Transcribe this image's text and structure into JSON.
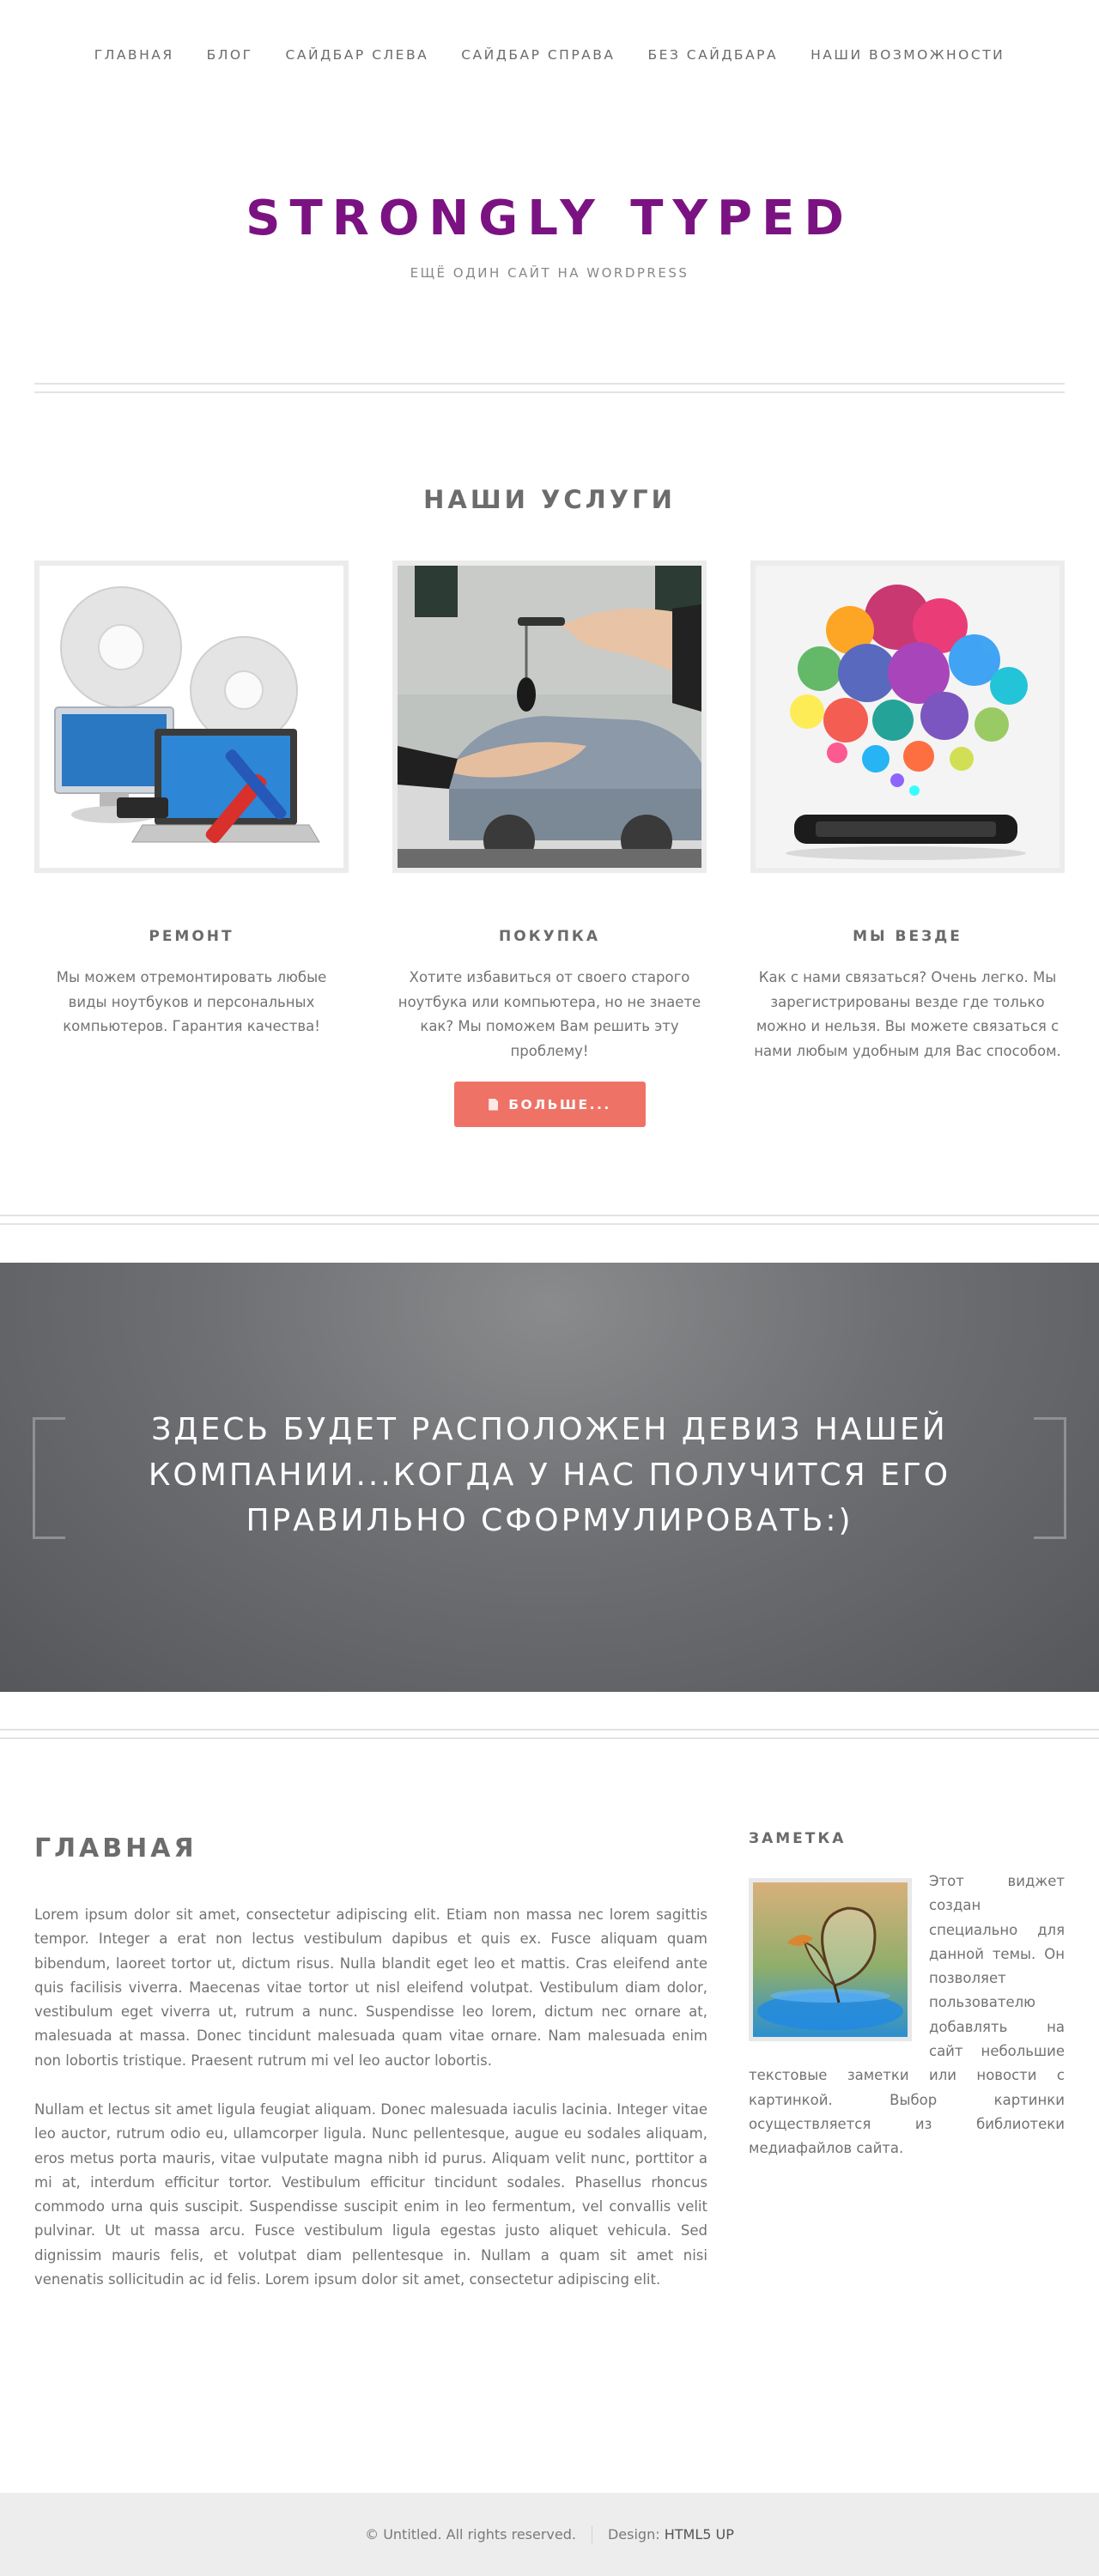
{
  "nav": {
    "items": [
      {
        "label": "ГЛАВНАЯ"
      },
      {
        "label": "БЛОГ"
      },
      {
        "label": "САЙДБАР СЛЕВА"
      },
      {
        "label": "САЙДБАР СПРАВА"
      },
      {
        "label": "БЕЗ САЙДБАРА"
      },
      {
        "label": "НАШИ ВОЗМОЖНОСТИ"
      }
    ]
  },
  "header": {
    "title": "STRONGLY TYPED",
    "tagline": "ЕЩЁ ОДИН САЙТ НА WORDPRESS"
  },
  "services": {
    "heading": "НАШИ УСЛУГИ",
    "items": [
      {
        "title": "РЕМОНТ",
        "text": "Мы можем отремонтировать любые виды ноутбуков и персональных компьютеров. Гарантия качества!"
      },
      {
        "title": "ПОКУПКА",
        "text": "Хотите избавиться от своего старого ноутбука или компьютера, но не знаете как? Мы поможем Вам решить эту проблему!"
      },
      {
        "title": "МЫ ВЕЗДЕ",
        "text": "Как с нами связаться? Очень легко. Мы зарегистрированы везде где только можно и нельзя. Вы можете связаться с нами любым удобным для Вас способом."
      }
    ],
    "more_label": "БОЛЬШЕ..."
  },
  "banner": {
    "text": "ЗДЕСЬ БУДЕТ РАСПОЛОЖЕН ДЕВИЗ НАШЕЙ КОМПАНИИ...КОГДА У НАС ПОЛУЧИТСЯ ЕГО ПРАВИЛЬНО СФОРМУЛИРОВАТЬ:)"
  },
  "main": {
    "heading": "ГЛАВНАЯ",
    "paragraphs": [
      "Lorem ipsum dolor sit amet, consectetur adipiscing elit. Etiam non massa nec lorem sagittis tempor. Integer a erat non lectus vestibulum dapibus et quis ex. Fusce aliquam quam bibendum, laoreet tortor ut, dictum risus. Nulla blandit eget leo et mattis. Cras eleifend ante quis facilisis viverra. Maecenas vitae tortor ut nisl eleifend volutpat. Vestibulum diam dolor, vestibulum eget viverra ut, rutrum a nunc. Suspendisse leo lorem, dictum nec ornare at, malesuada at massa. Donec tincidunt malesuada quam vitae ornare. Nam malesuada enim non lobortis tristique. Praesent rutrum mi vel leo auctor lobortis.",
      "Nullam et lectus sit amet ligula feugiat aliquam. Donec malesuada iaculis lacinia. Integer vitae leo auctor, rutrum odio eu, ullamcorper ligula. Nunc pellentesque, augue eu sodales aliquam, eros metus porta mauris, vitae vulputate magna nibh id purus. Aliquam velit nunc, porttitor a mi at, interdum efficitur tortor. Vestibulum efficitur tincidunt sodales. Phasellus rhoncus commodo urna quis suscipit. Suspendisse suscipit enim in leo fermentum, vel convallis velit pulvinar. Ut ut massa arcu. Fusce vestibulum ligula egestas justo aliquet vehicula. Sed dignissim mauris felis, et volutpat diam pellentesque in. Nullam a quam sit amet nisi venenatis sollicitudin ac id felis. Lorem ipsum dolor sit amet, consectetur adipiscing elit."
    ]
  },
  "sidebar": {
    "heading": "ЗАМЕТКА",
    "text": "Этот виджет создан специально для данной темы. Он позволяет пользователю добавлять на сайт небольшие текстовые заметки или новости с картинкой. Выбор картинки осуществляется из библиотеки медиафайлов сайта."
  },
  "footer": {
    "copyright": "© Untitled. All rights reserved.",
    "design_label": "Design:",
    "design_link": "HTML5 UP"
  },
  "colors": {
    "title": "#7b1282",
    "button": "#ee7366",
    "banner": "#6e6f72",
    "footer_bg": "#ededed"
  }
}
